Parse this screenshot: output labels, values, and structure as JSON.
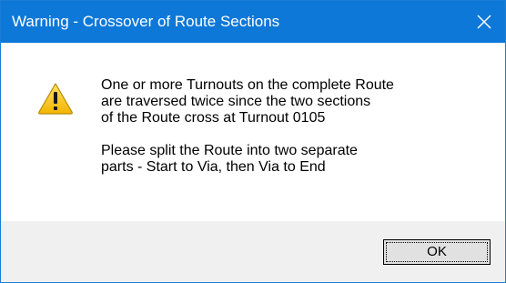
{
  "window": {
    "title": "Warning - Crossover of Route Sections",
    "titlebar_color": "#0d78d8",
    "close_icon": "close-icon"
  },
  "message": {
    "icon": "warning-icon",
    "lines": [
      "One or more Turnouts on the complete Route",
      "are traversed twice since the two sections",
      "of the Route cross at Turnout 0105",
      "",
      "Please split the Route into two separate",
      "parts - Start to Via, then Via to End"
    ]
  },
  "buttons": {
    "ok_label": "OK"
  }
}
